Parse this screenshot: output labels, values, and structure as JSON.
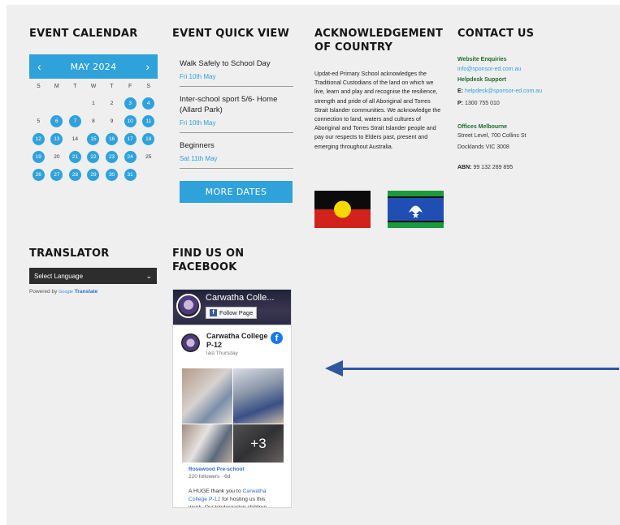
{
  "sections": {
    "event_calendar": "EVENT CALENDAR",
    "event_quick_view": "EVENT QUICK VIEW",
    "acknowledgement_line1": "ACKNOWLEDGEMENT",
    "acknowledgement_line2": "OF COUNTRY",
    "contact_us": "CONTACT US",
    "translator": "TRANSLATOR",
    "facebook_line1": "FIND US ON",
    "facebook_line2": "FACEBOOK"
  },
  "calendar": {
    "month": "MAY 2024",
    "prev_icon": "chevron-left-icon",
    "next_icon": "chevron-right-icon",
    "weekdays": [
      "S",
      "M",
      "T",
      "W",
      "T",
      "F",
      "S"
    ],
    "weeks": [
      [
        null,
        null,
        null,
        {
          "d": "1",
          "ev": false
        },
        {
          "d": "2",
          "ev": false
        },
        {
          "d": "3",
          "ev": true
        },
        {
          "d": "4",
          "ev": true
        }
      ],
      [
        {
          "d": "5",
          "ev": false
        },
        {
          "d": "6",
          "ev": true
        },
        {
          "d": "7",
          "ev": true
        },
        {
          "d": "8",
          "ev": false
        },
        {
          "d": "9",
          "ev": false
        },
        {
          "d": "10",
          "ev": true
        },
        {
          "d": "11",
          "ev": true
        }
      ],
      [
        {
          "d": "12",
          "ev": true
        },
        {
          "d": "13",
          "ev": true
        },
        {
          "d": "14",
          "ev": false
        },
        {
          "d": "15",
          "ev": true
        },
        {
          "d": "16",
          "ev": true
        },
        {
          "d": "17",
          "ev": true
        },
        {
          "d": "18",
          "ev": true
        }
      ],
      [
        {
          "d": "19",
          "ev": true
        },
        {
          "d": "20",
          "ev": false
        },
        {
          "d": "21",
          "ev": true
        },
        {
          "d": "22",
          "ev": true
        },
        {
          "d": "23",
          "ev": true
        },
        {
          "d": "24",
          "ev": true
        },
        {
          "d": "25",
          "ev": false
        }
      ],
      [
        {
          "d": "26",
          "ev": true
        },
        {
          "d": "27",
          "ev": true
        },
        {
          "d": "28",
          "ev": true
        },
        {
          "d": "29",
          "ev": true
        },
        {
          "d": "30",
          "ev": true
        },
        {
          "d": "31",
          "ev": true
        },
        null
      ]
    ],
    "accent": "#2fa2dc"
  },
  "quick_view": {
    "events": [
      {
        "title": "Walk Safely to School Day",
        "date": "Fri 10th May"
      },
      {
        "title": "Inter-school sport 5/6- Home (Allard Park)",
        "date": "Fri 10th May"
      },
      {
        "title": "Beginners",
        "date": "Sat 11th May"
      }
    ],
    "more_button": "MORE DATES"
  },
  "acknowledgement": {
    "text": "Updat-ed Primary School acknowledges the Traditional Custodians of the land on which we live, learn and play and recognise the resilience, strength and pride of all Aboriginal and Torres Strait Islander communities. We acknowledge the connection to land, waters and cultures of Aboriginal and Torres Strait Islander people and pay our respects to Elders past, present and emerging throughout Australia."
  },
  "contact": {
    "website_label": "Website Enquiries",
    "website_email": "info@sponsor-ed.com.au",
    "helpdesk_label": "Helpdesk Support",
    "helpdesk_email_prefix": "E:",
    "helpdesk_email": "helpdesk@sponsor-ed.com.au",
    "helpdesk_phone_prefix": "P:",
    "helpdesk_phone": "1300 755 010",
    "office_label": "Offices Melbourne",
    "office_line1": "Street Level, 700 Collins St",
    "office_line2": "Docklands VIC 3008",
    "abn_label": "ABN:",
    "abn_value": "99 132 289 895"
  },
  "translator": {
    "select_value": "Select Language",
    "powered_by": "Powered by",
    "google": "Google",
    "translate": "Translate"
  },
  "facebook": {
    "cover_name": "Carwatha Colle...",
    "follow_label": "Follow Page",
    "page_name": "Carwatha College P-12",
    "post_time": "last Thursday",
    "more_photos": "+3",
    "link_title": "Rosewood Pre-school",
    "followers": "220 followers · 6d",
    "post_text_start": "A HUGE thank you to ",
    "post_text_link": "Carwatha College P-12",
    "post_text_end": " for hosting us this week. Our kindergarten children"
  }
}
